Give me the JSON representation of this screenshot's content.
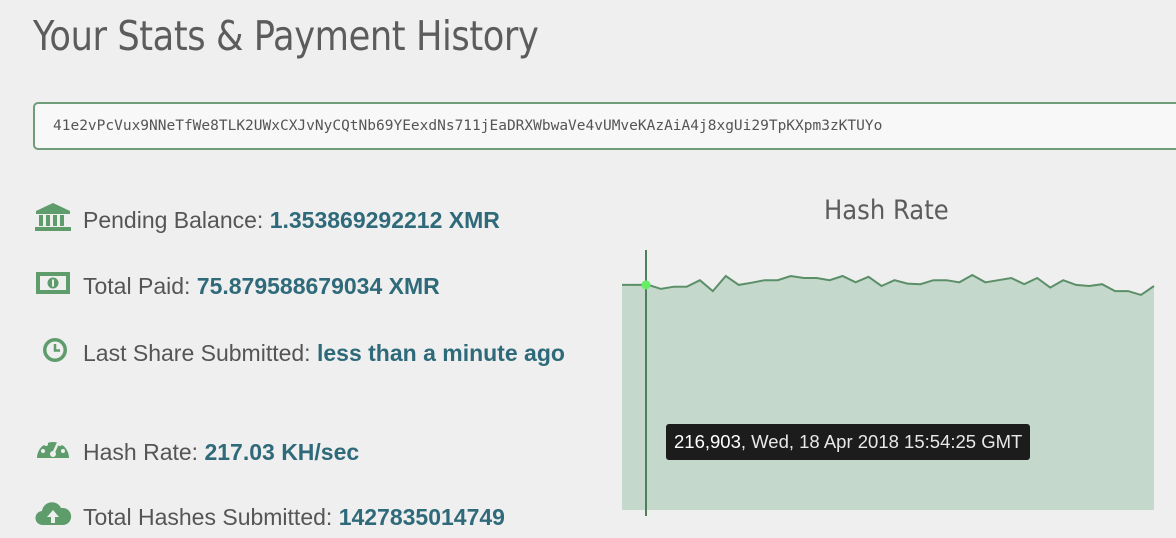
{
  "page": {
    "title": "Your Stats & Payment History"
  },
  "address": {
    "value": "41e2vPcVux9NNeTfWe8TLK2UWxCXJvNyCQtNb69YEexdNs711jEaDRXWbwaVe4vUMveKAzAiA4j8xgUi29TpKXpm3zKTUYo"
  },
  "stats": {
    "pending_balance": {
      "icon": "bank-icon",
      "label": "Pending Balance:",
      "value": "1.353869292212 XMR"
    },
    "total_paid": {
      "icon": "banknote-icon",
      "label": "Total Paid:",
      "value": "75.879588679034 XMR"
    },
    "last_share": {
      "icon": "clock-icon",
      "label": "Last Share Submitted:",
      "value": "less than a minute ago"
    },
    "hash_rate": {
      "icon": "speedometer-icon",
      "label": "Hash Rate:",
      "value": "217.03 KH/sec"
    },
    "total_hashes": {
      "icon": "cloud-upload-icon",
      "label": "Total Hashes Submitted:",
      "value": "1427835014749"
    }
  },
  "colors": {
    "accent_green": "#5e9c6c",
    "value_blue": "#2f6a7a",
    "chart_fill": "#c4d8cb",
    "chart_line": "#5b8f68",
    "cursor_point": "#66ee66"
  },
  "chart_data": {
    "type": "area",
    "title": "Hash Rate",
    "ylim": [
      0,
      260000
    ],
    "hover_index": 1,
    "series": [
      {
        "values": [
          216800,
          216800,
          216903,
          212900,
          215000,
          215100,
          221300,
          210800,
          225300,
          216800,
          218900,
          221300,
          221300,
          225300,
          223400,
          223400,
          221300,
          225300,
          219300,
          224600,
          215700,
          221300,
          218000,
          217400,
          221300,
          221300,
          219300,
          226300,
          219300,
          221300,
          223400,
          217400,
          223400,
          214200,
          221300,
          216800,
          215700,
          217400,
          210800,
          210800,
          207100,
          215700
        ]
      }
    ]
  },
  "tooltip": {
    "value": "216,903",
    "timestamp": ", Wed, 18 Apr 2018 15:54:25 GMT"
  }
}
